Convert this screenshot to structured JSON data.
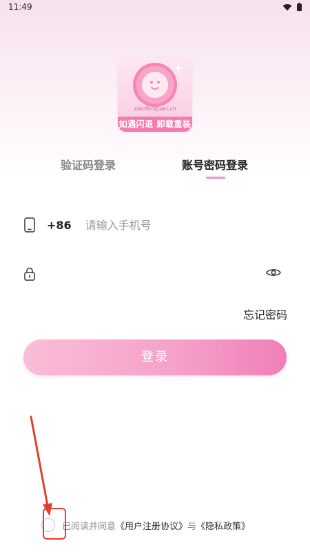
{
  "status_bar": {
    "time": "11:49",
    "icons": [
      "wifi-icon",
      "battery-icon"
    ]
  },
  "logo": {
    "site_text": "xiaofenquan.cn",
    "band_text": "如遇闪退 卸载重装"
  },
  "tabs": [
    {
      "label": "验证码登录",
      "active": false
    },
    {
      "label": "账号密码登录",
      "active": true
    }
  ],
  "phone": {
    "country_code": "+86",
    "placeholder": "请输入手机号",
    "value": ""
  },
  "password": {
    "placeholder": "",
    "value": ""
  },
  "forgot_label": "忘记密码",
  "login_label": "登录",
  "agreement": {
    "prefix": "已阅读并同意",
    "user_agreement": "《用户注册协议》",
    "connector": "与",
    "privacy_policy": "《隐私政策》",
    "checked": false
  },
  "colors": {
    "accent": "#f48fbf",
    "button_start": "#f9bdd7",
    "button_end": "#f07fb6",
    "annotation": "#e0402c"
  }
}
